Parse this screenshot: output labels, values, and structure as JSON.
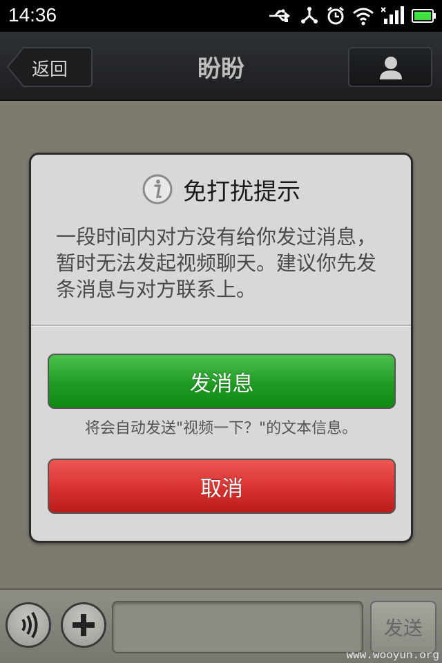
{
  "status_bar": {
    "time": "14:36",
    "icons": [
      "usb-icon",
      "share-icon",
      "alarm-icon",
      "wifi-icon",
      "signal-icon",
      "battery-icon"
    ]
  },
  "navbar": {
    "back_label": "返回",
    "title": "盼盼",
    "right_icon": "profile-icon"
  },
  "dialog": {
    "title": "免打扰提示",
    "title_icon": "info-icon",
    "message": "一段时间内对方没有给你发过消息，暂时无法发起视频聊天。建议你先发条消息与对方联系上。",
    "send_button_label": "发消息",
    "note": "将会自动发送\"视频一下？\"的文本信息。",
    "cancel_button_label": "取消",
    "colors": {
      "send": "#1f9b23",
      "cancel": "#d6322f"
    }
  },
  "input_bar": {
    "voice_icon": "voice-icon",
    "plus_icon": "plus-icon",
    "input_value": "",
    "send_label": "发送"
  },
  "watermark": "www.wooyun.org"
}
